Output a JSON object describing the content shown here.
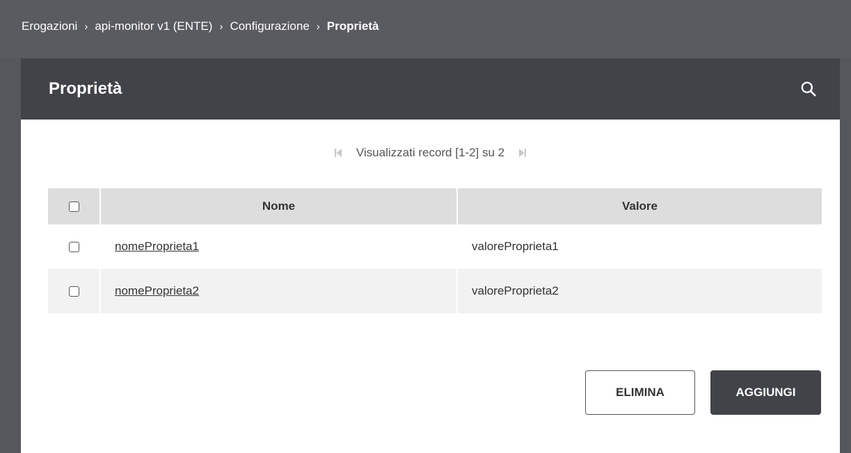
{
  "breadcrumb": {
    "items": [
      "Erogazioni",
      "api-monitor v1 (ENTE)",
      "Configurazione"
    ],
    "separator": "›",
    "current": "Proprietà"
  },
  "panel": {
    "title": "Proprietà",
    "search_icon": "search-icon"
  },
  "pager": {
    "first_icon": "⏮",
    "text": "Visualizzati record [1-2] su 2",
    "last_icon": "⏭"
  },
  "table": {
    "headers": {
      "name": "Nome",
      "value": "Valore"
    },
    "rows": [
      {
        "name": "nomeProprieta1",
        "value": "valoreProprieta1"
      },
      {
        "name": "nomeProprieta2",
        "value": "valoreProprieta2"
      }
    ]
  },
  "actions": {
    "delete_label": "ELIMINA",
    "add_label": "AGGIUNGI"
  },
  "colors": {
    "header_bg": "#424348",
    "breadcrumb_bg": "#5a5b60",
    "table_header_bg": "#dddddd"
  }
}
